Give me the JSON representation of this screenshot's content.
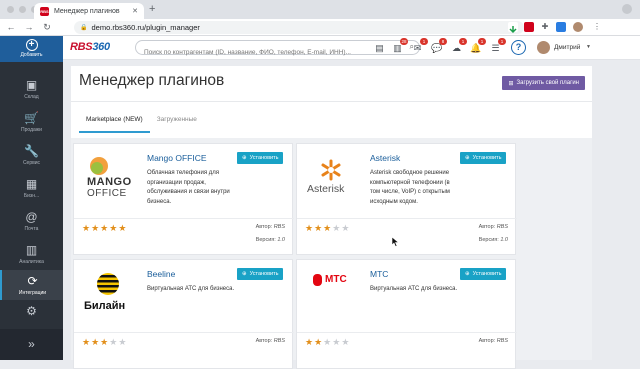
{
  "browser": {
    "tab_title": "Менеджер плагинов",
    "url": "demo.rbs360.ru/plugin_manager"
  },
  "sidebar": {
    "add_label": "Добавить",
    "items": [
      {
        "label": "Склад",
        "icon": "box-icon"
      },
      {
        "label": "Продажи",
        "icon": "cart-icon"
      },
      {
        "label": "Сервис",
        "icon": "wrench-icon"
      },
      {
        "label": "Бизн...",
        "icon": "grid-icon"
      },
      {
        "label": "Почта",
        "icon": "at-icon"
      },
      {
        "label": "Аналитика",
        "icon": "chart-icon"
      },
      {
        "label": "Интеграции",
        "icon": "sync-icon"
      },
      {
        "label": "",
        "icon": "gear-icon"
      }
    ]
  },
  "header": {
    "logo_text": "RBS",
    "logo_num": "360",
    "search_placeholder": "Поиск по контрагентам (ID, название, ФИО, телефон, E-mail, ИНН)...",
    "badges": [
      "28",
      "1",
      "8",
      "1",
      "1",
      "1",
      "1"
    ],
    "user": "Дмитрий"
  },
  "page": {
    "title": "Менеджер плагинов",
    "upload_label": "Загрузить свой плагин",
    "tabs": [
      "Marketplace (NEW)",
      "Загруженные"
    ]
  },
  "plugins": [
    {
      "name": "Mango OFFICE",
      "desc": "Облачная телефония для организации продаж, обслуживания и связи внутри бизнеса.",
      "install": "Установить",
      "rating": 5,
      "author_label": "Автор:",
      "author": "RBS",
      "version_label": "Версия:",
      "version": "1.0",
      "logo": "mango-logo",
      "logo_text1": "MANGO",
      "logo_text2": "OFFICE"
    },
    {
      "name": "Asterisk",
      "desc": "Asterisk свободное решение компьютерной телефонии (в том числе, VoIP) с открытым исходным кодом.",
      "install": "Установить",
      "rating": 3,
      "author_label": "Автор:",
      "author": "RBS",
      "version_label": "Версия:",
      "version": "1.0",
      "logo": "asterisk-logo",
      "logo_text1": "Asterisk"
    },
    {
      "name": "Beeline",
      "desc": "Виртуальная АТС для бизнеса.",
      "install": "Установить",
      "rating": 3,
      "author_label": "Автор:",
      "author": "RBS",
      "logo": "beeline-logo",
      "logo_text1": "Билайн"
    },
    {
      "name": "МТС",
      "desc": "Виртуальная АТС для бизнеса.",
      "install": "Установить",
      "rating": 2,
      "author_label": "Автор:",
      "author": "RBS",
      "logo": "mts-logo",
      "logo_text1": "МТС"
    }
  ],
  "colors": {
    "sidebar": "#2b3139",
    "accent_blue": "#19a2c6",
    "upload_purple": "#6f5aa3",
    "star_on": "#e28f1b"
  }
}
